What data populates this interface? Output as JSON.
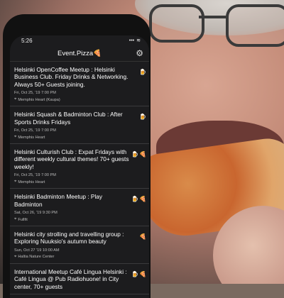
{
  "status_bar": {
    "time": "5:26",
    "signal": "•••",
    "wifi": "≋"
  },
  "app": {
    "title": "Event.Pizza",
    "title_icon": "pizza-emoji",
    "settings_icon": "gear-icon"
  },
  "events": [
    {
      "title": "Helsinki OpenCoffee Meetup : Helsinki Business Club. Friday Drinks & Networking.  Always 50+ Guests joining.",
      "date": "Fri, Oct 25, '19 7:00 PM",
      "venue": "Memphis Heart (Kaupa)",
      "badges": [
        "🍺"
      ]
    },
    {
      "title": "Helsinki Squash & Badminton Club : After Sports Drinks Fridays",
      "date": "Fri, Oct 25, '19 7:00 PM",
      "venue": "Memphis Heart",
      "badges": [
        "🍺"
      ]
    },
    {
      "title": "Helsinki Culturish Club : Expat Fridays with different weekly cultural themes! 70+ guests weekly!",
      "date": "Fri, Oct 25, '19 7:00 PM",
      "venue": "Memphis Heart",
      "badges": [
        "🍺",
        "🍕"
      ]
    },
    {
      "title": "Helsinki Badminton Meetup : Play Badminton",
      "date": "Sat, Oct 26, '19 9:30 PM",
      "venue": "Fullfit",
      "badges": [
        "🍺",
        "🍕"
      ]
    },
    {
      "title": "Helsinki city strolling and travelling group : Exploring Nuuksio's autumn beauty",
      "date": "Sun, Oct 27 '19 10:00 AM",
      "venue": "Haltia Nature Center",
      "badges": [
        "🍕"
      ]
    },
    {
      "title": "International Meetup Café Lingua Helsinki : Café Lingua @ Pub Radiohuone! in City center, 70+ guests",
      "date": "",
      "venue": "",
      "badges": [
        "🍺",
        "🍕"
      ]
    }
  ]
}
